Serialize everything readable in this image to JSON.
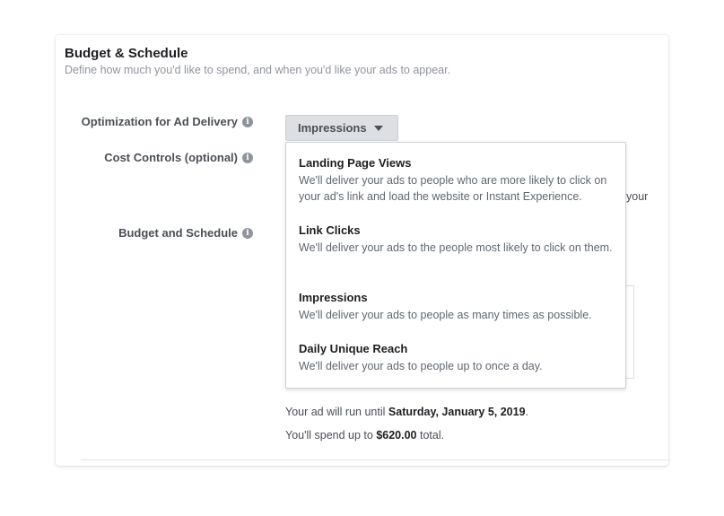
{
  "section": {
    "title": "Budget & Schedule",
    "subtitle": "Define how much you'd like to spend, and when you'd like your ads to appear."
  },
  "rows": {
    "optimization": "Optimization for Ad Delivery",
    "cost_controls": "Cost Controls (optional)",
    "budget_schedule": "Budget and Schedule"
  },
  "dropdown": {
    "selected": "Impressions",
    "options": [
      {
        "title": "Landing Page Views",
        "desc": "We'll deliver your ads to people who are more likely to click on your ad's link and load the website or Instant Experience."
      },
      {
        "title": "Link Clicks",
        "desc": "We'll deliver your ads to the people most likely to click on them."
      },
      {
        "title": "Impressions",
        "desc": "We'll deliver your ads to people as many times as possible."
      },
      {
        "title": "Daily Unique Reach",
        "desc": "We'll deliver your ads to people up to once a day."
      }
    ]
  },
  "partial_text": "your",
  "footer": {
    "run_prefix": "Your ad will run until",
    "run_date": "Saturday, January 5, 2019",
    "run_suffix": ".",
    "spend_prefix": "You'll spend up to",
    "spend_amount": "$620.00",
    "spend_suffix": "total."
  },
  "icons": {
    "info": "info-icon",
    "caret": "caret-down-icon"
  }
}
